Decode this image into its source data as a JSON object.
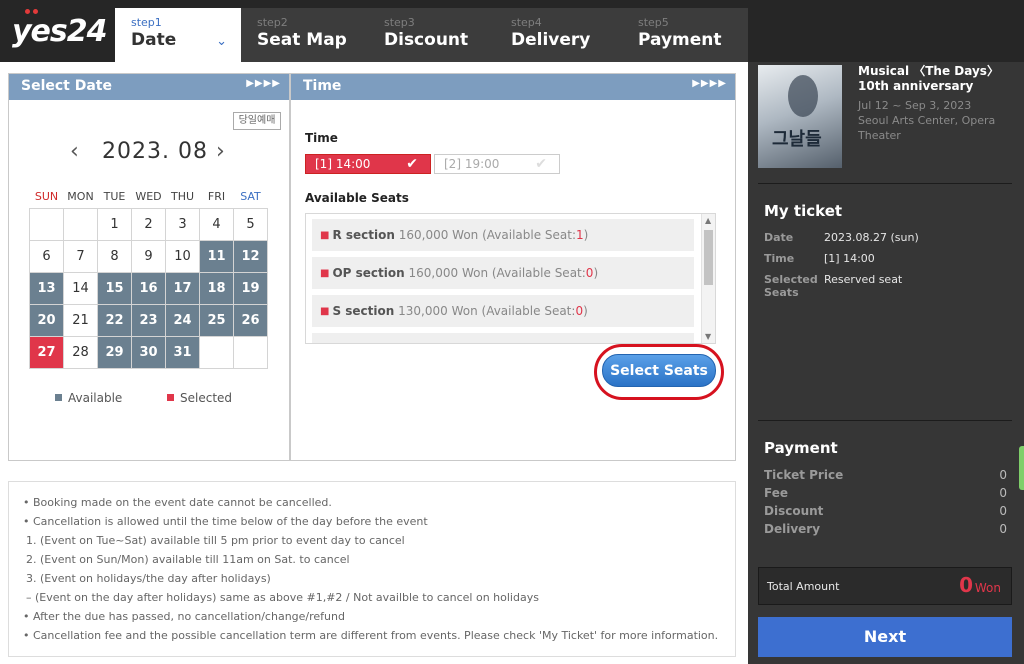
{
  "brand": {
    "logo_text": "yes24"
  },
  "steps": [
    {
      "num": "step1",
      "label": "Date",
      "active": true
    },
    {
      "num": "step2",
      "label": "Seat Map"
    },
    {
      "num": "step3",
      "label": "Discount"
    },
    {
      "num": "step4",
      "label": "Delivery"
    },
    {
      "num": "step5",
      "label": "Payment"
    }
  ],
  "date_panel": {
    "title": "Select Date",
    "arrows": "▶▶▶▶",
    "same_day_button": "당일예매",
    "month": "2023. 08",
    "prev": "‹",
    "next": "›",
    "weekdays": [
      "SUN",
      "MON",
      "TUE",
      "WED",
      "THU",
      "FRI",
      "SAT"
    ],
    "weeks": [
      [
        "",
        "",
        "1",
        "2",
        "3",
        "4",
        "5"
      ],
      [
        "6",
        "7",
        "8",
        "9",
        "10",
        "11",
        "12"
      ],
      [
        "13",
        "14",
        "15",
        "16",
        "17",
        "18",
        "19"
      ],
      [
        "20",
        "21",
        "22",
        "23",
        "24",
        "25",
        "26"
      ],
      [
        "27",
        "28",
        "29",
        "30",
        "31",
        "",
        ""
      ]
    ],
    "available_days": [
      "11",
      "12",
      "13",
      "15",
      "16",
      "17",
      "18",
      "19",
      "20",
      "22",
      "23",
      "24",
      "25",
      "26",
      "29",
      "30",
      "31"
    ],
    "selected_day": "27",
    "legend_available": "Available",
    "legend_selected": "Selected",
    "color_available": "#6b8090",
    "color_selected": "#e0364a"
  },
  "time_panel": {
    "title": "Time",
    "arrows": "▶▶▶▶",
    "time_label": "Time",
    "times": [
      {
        "label": "[1] 14:00",
        "selected": true
      },
      {
        "label": "[2] 19:00",
        "selected": false
      }
    ],
    "seats_label": "Available Seats",
    "seats": [
      {
        "section": "R section",
        "price": "160,000 Won",
        "avail_label": "(Available Seat:",
        "count": "1",
        "close": ")"
      },
      {
        "section": "OP section",
        "price": "160,000 Won",
        "avail_label": "(Available Seat:",
        "count": "0",
        "close": ")"
      },
      {
        "section": "S section",
        "price": "130,000 Won",
        "avail_label": "(Available Seat:",
        "count": "0",
        "close": ")"
      }
    ],
    "select_seats_button": "Select Seats"
  },
  "notice": [
    "• Booking made on the event date cannot be cancelled.",
    "• Cancellation is allowed until the time below of the day before the event",
    "  1. (Event on Tue~Sat) available till 5 pm prior to event day to cancel",
    "  2. (Event on Sun/Mon) available till 11am on Sat. to cancel",
    "  3. (Event on holidays/the day after holidays)",
    "  – (Event on the day after holidays) same as above #1,#2 / Not availble to cancel on holidays",
    "• After the due has passed, no cancellation/change/refund",
    "• Cancellation fee and the possible cancellation term are different from events. Please check 'My Ticket' for more information."
  ],
  "sidebar": {
    "show_title": "Musical 〈The Days〉 10th anniversary",
    "show_dates": "Jul 12 ~ Sep 3, 2023",
    "show_venue": "Seoul Arts Center, Opera Theater",
    "poster_text": "그날들",
    "my_ticket_heading": "My ticket",
    "ticket": [
      {
        "key": "Date",
        "value": "2023.08.27 (sun)"
      },
      {
        "key": "Time",
        "value": "[1] 14:00"
      },
      {
        "key": "Selected Seats",
        "value": "Reserved seat"
      }
    ],
    "payment_heading": "Payment",
    "payment": [
      {
        "key": "Ticket Price",
        "value": "0"
      },
      {
        "key": "Fee",
        "value": "0"
      },
      {
        "key": "Discount",
        "value": "0"
      },
      {
        "key": "Delivery",
        "value": "0"
      }
    ],
    "total_label": "Total Amount",
    "total_value": "0",
    "total_unit": "Won",
    "next_button": "Next"
  }
}
